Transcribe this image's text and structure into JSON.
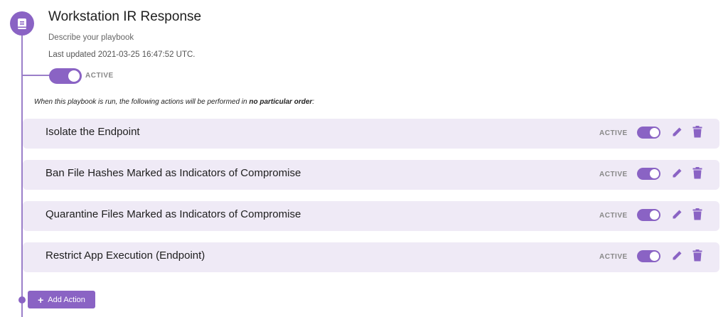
{
  "playbook": {
    "title": "Workstation IR Response",
    "description": "Describe your playbook",
    "last_updated": "Last updated 2021-03-25 16:47:52 UTC.",
    "active": true,
    "status_label": "ACTIVE",
    "order_note_prefix": "When this playbook is run, the following actions will be performed in ",
    "order_note_emphasis": "no particular order",
    "order_note_suffix": ":"
  },
  "actions": [
    {
      "label": "Isolate the Endpoint",
      "status": "ACTIVE",
      "active": true
    },
    {
      "label": "Ban File Hashes Marked as Indicators of Compromise",
      "status": "ACTIVE",
      "active": true
    },
    {
      "label": "Quarantine Files Marked as Indicators of Compromise",
      "status": "ACTIVE",
      "active": true
    },
    {
      "label": "Restrict App Execution (Endpoint)",
      "status": "ACTIVE",
      "active": true
    }
  ],
  "add_action": {
    "label": "Add Action",
    "icon": "plus-icon"
  },
  "icons": {
    "playbook": "book-icon",
    "edit": "pencil-icon",
    "delete": "trash-icon"
  },
  "colors": {
    "accent": "#8a63c4",
    "row_background": "#efeaf6",
    "timeline": "#9b7fc9"
  }
}
